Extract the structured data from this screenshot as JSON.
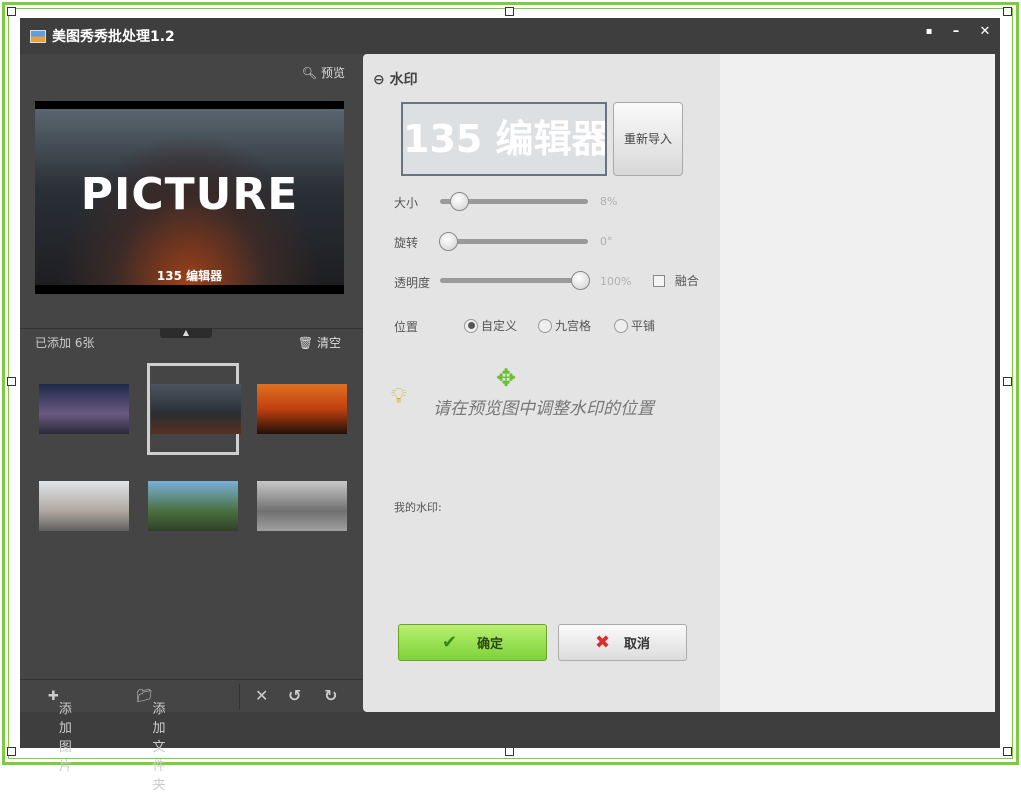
{
  "window": {
    "title": "美图秀秀批处理1.2",
    "controls": [
      "feedback",
      "minimize",
      "close"
    ]
  },
  "left": {
    "preview_label": "预览",
    "preview_image": {
      "main_text": "PICTURE",
      "watermark": "135 编辑器"
    },
    "count_label": "已添加 6张",
    "clear_label": "清空",
    "thumbnails": 6,
    "selected_index": 1,
    "toolbar": {
      "add_image": "添加图片",
      "add_folder": "添加文件夹"
    }
  },
  "watermark": {
    "title": "水印",
    "preview_text": "135 编辑器",
    "reimport": "重新导入",
    "size": {
      "label": "大小",
      "value": "8%",
      "fraction": 0.08
    },
    "rotate": {
      "label": "旋转",
      "value": "0°",
      "fraction": 0
    },
    "opacity": {
      "label": "透明度",
      "value": "100%",
      "fraction": 1.0
    },
    "blend": {
      "label": "融合",
      "checked": false
    },
    "position": {
      "label": "位置",
      "options": [
        "自定义",
        "九宫格",
        "平铺"
      ],
      "selected": "自定义"
    },
    "hint": "请在预览图中调整水印的位置",
    "my_watermark": "我的水印:",
    "ok": "确定",
    "cancel": "取消"
  },
  "colors": {
    "accent": "#7ecb3f",
    "ok_button": "#8fdc48",
    "cancel_x": "#d83030"
  }
}
